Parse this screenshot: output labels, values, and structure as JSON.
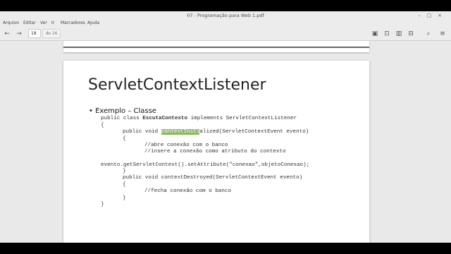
{
  "window": {
    "title": "07 - Programação para Web 1.pdf"
  },
  "menu": [
    "Arquivo",
    "Editar",
    "Ver",
    "Ir",
    "Marcadores",
    "Ajuda"
  ],
  "toolbar": {
    "page_current": "18",
    "page_total": "de 26"
  },
  "slide": {
    "title": "ServletContextListener",
    "bullet": "• Exemplo – Classe",
    "code": {
      "l1_a": "public class ",
      "l1_b": "EscutaContexto",
      "l1_c": " implements ServletContextListener",
      "l2": "{",
      "l3_a": "public void ",
      "l3_hl": "contextIniti",
      "l3_c": "alized(ServletContextEvent evento)",
      "l4": "{",
      "l5": "//abre conexão com o banco",
      "l6": "//insere a conexão como atributo do contexto",
      "l7": "evento.getServletContext().setAttribute(\"conexao\",objetoConexao);",
      "l8": "}",
      "l9": "public void contextDestroyed(ServletContextEvent evento)",
      "l10": "{",
      "l11": "//fecha conexão com o banco",
      "l12": "}",
      "l13": "}"
    }
  }
}
